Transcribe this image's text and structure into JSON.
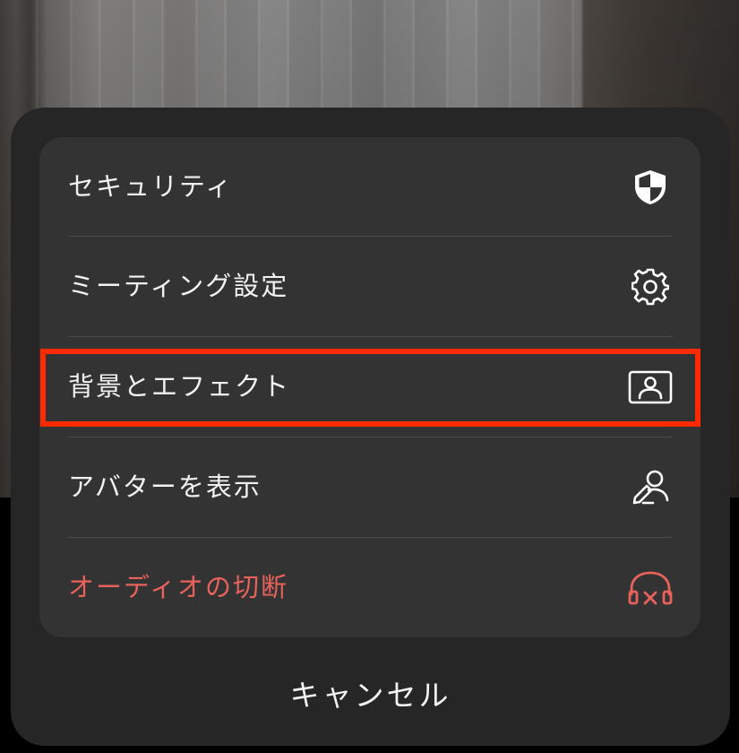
{
  "menu": {
    "items": [
      {
        "label": "セキュリティ",
        "icon": "shield-icon"
      },
      {
        "label": "ミーティング設定",
        "icon": "gear-icon"
      },
      {
        "label": "背景とエフェクト",
        "icon": "background-portrait-icon"
      },
      {
        "label": "アバターを表示",
        "icon": "avatar-edit-icon"
      },
      {
        "label": "オーディオの切断",
        "icon": "headphones-disconnect-icon"
      }
    ],
    "cancel_label": "キャンセル"
  },
  "colors": {
    "sheet_bg": "#262626",
    "card_bg": "#333333",
    "text": "#f2f2f2",
    "danger": "#e8625c",
    "highlight_border": "#ff2a00"
  }
}
